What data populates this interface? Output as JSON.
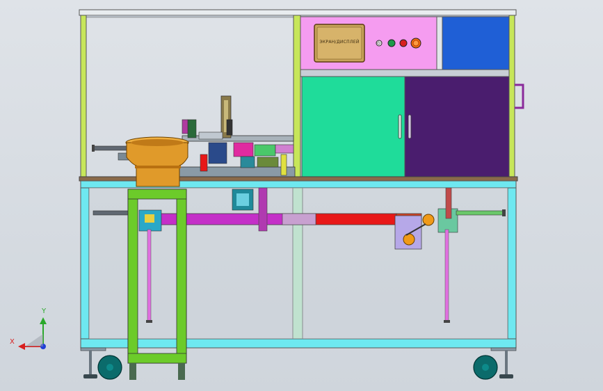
{
  "hmi": {
    "label": "ЭКРАН/ДИСПЛЕЙ"
  },
  "axis_triad": {
    "x_label": "X",
    "y_label": "Y"
  },
  "panel_button": {
    "glyph": "⏻"
  },
  "colors": {
    "frame_lower": "#6ee8f0",
    "frame_upper": "#c7e65a",
    "control_panel": "#f59cf0",
    "blue_panel": "#1f5fd6",
    "door_left": "#1fdc9a",
    "door_right": "#4a1d6e",
    "vibratory_bowl": "#e09a2a",
    "green_stand": "#6ccb2a",
    "rail_magenta": "#c42fc8",
    "rail_red": "#e81818",
    "wheel": "#0b6b6b"
  }
}
